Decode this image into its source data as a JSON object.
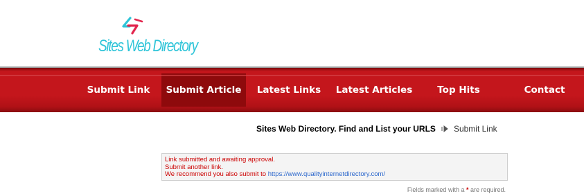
{
  "logo": {
    "text": "Sites Web Directory",
    "colors": {
      "primary": "#2ec4d8",
      "accent": "#e2264d"
    }
  },
  "nav": {
    "items": [
      {
        "label": "Submit Link",
        "active": false
      },
      {
        "label": "Submit Article",
        "active": true
      },
      {
        "label": "Latest Links",
        "active": false
      },
      {
        "label": "Latest Articles",
        "active": false
      },
      {
        "label": "Top Hits",
        "active": false
      },
      {
        "label": "Contact",
        "active": false
      }
    ],
    "colors": {
      "bar": "#c4161c",
      "active": "#8e0a0c",
      "text": "#ffffff"
    }
  },
  "breadcrumb": {
    "site": "Sites Web Directory. Find and List your URLS",
    "separator_icon": "arrow-right-icon",
    "current": "Submit Link"
  },
  "message": {
    "line1": "Link submitted and awaiting approval.",
    "line2": "Submit another link.",
    "line3_prefix": "We recommend you also submit to ",
    "line3_link": "https://www.qualityinternetdirectory.com/"
  },
  "required_note": {
    "prefix": "Fields marked with a ",
    "star": "*",
    "suffix": " are required."
  }
}
